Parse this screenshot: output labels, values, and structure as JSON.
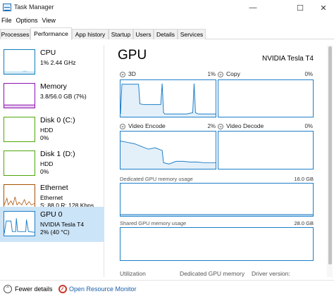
{
  "window": {
    "title": "Task Manager",
    "minimize": "—",
    "maximize": "☐",
    "close": "✕"
  },
  "menu": [
    "File",
    "Options",
    "View"
  ],
  "tabs": [
    "Processes",
    "Performance",
    "App history",
    "Startup",
    "Users",
    "Details",
    "Services"
  ],
  "active_tab": "Performance",
  "sidebar": {
    "items": [
      {
        "title": "CPU",
        "lines": [
          "1%  2.44 GHz"
        ],
        "color": "#117dbb"
      },
      {
        "title": "Memory",
        "lines": [
          "3.8/56.0 GB (7%)"
        ],
        "color": "#8b12ae"
      },
      {
        "title": "Disk 0 (C:)",
        "lines": [
          "HDD",
          "0%"
        ],
        "color": "#4da60c"
      },
      {
        "title": "Disk 1 (D:)",
        "lines": [
          "HDD",
          "0%"
        ],
        "color": "#4da60c"
      },
      {
        "title": "Ethernet",
        "lines": [
          "Ethernet",
          "S: 88.0  R: 128 Kbps"
        ],
        "color": "#a74f01"
      },
      {
        "title": "GPU 0",
        "lines": [
          "NVIDIA Tesla T4",
          "2%  (40 °C)"
        ],
        "color": "#1e7ec8",
        "selected": true
      }
    ]
  },
  "main": {
    "title": "GPU",
    "gpu_name": "NVIDIA Tesla T4",
    "engines": [
      {
        "label": "3D",
        "percent": "1%"
      },
      {
        "label": "Copy",
        "percent": "0%"
      },
      {
        "label": "Video Encode",
        "percent": "2%"
      },
      {
        "label": "Video Decode",
        "percent": "0%"
      }
    ],
    "dedicated_memory": {
      "label": "Dedicated GPU memory usage",
      "max": "16.0 GB"
    },
    "shared_memory": {
      "label": "Shared GPU memory usage",
      "max": "28.0 GB"
    },
    "stats_labels": [
      "Utilization",
      "Dedicated GPU memory",
      "Driver version:"
    ],
    "accent_color": "#1e7ec8"
  },
  "footer": {
    "fewer_details": "Fewer details",
    "open_monitor": "Open Resource Monitor"
  }
}
